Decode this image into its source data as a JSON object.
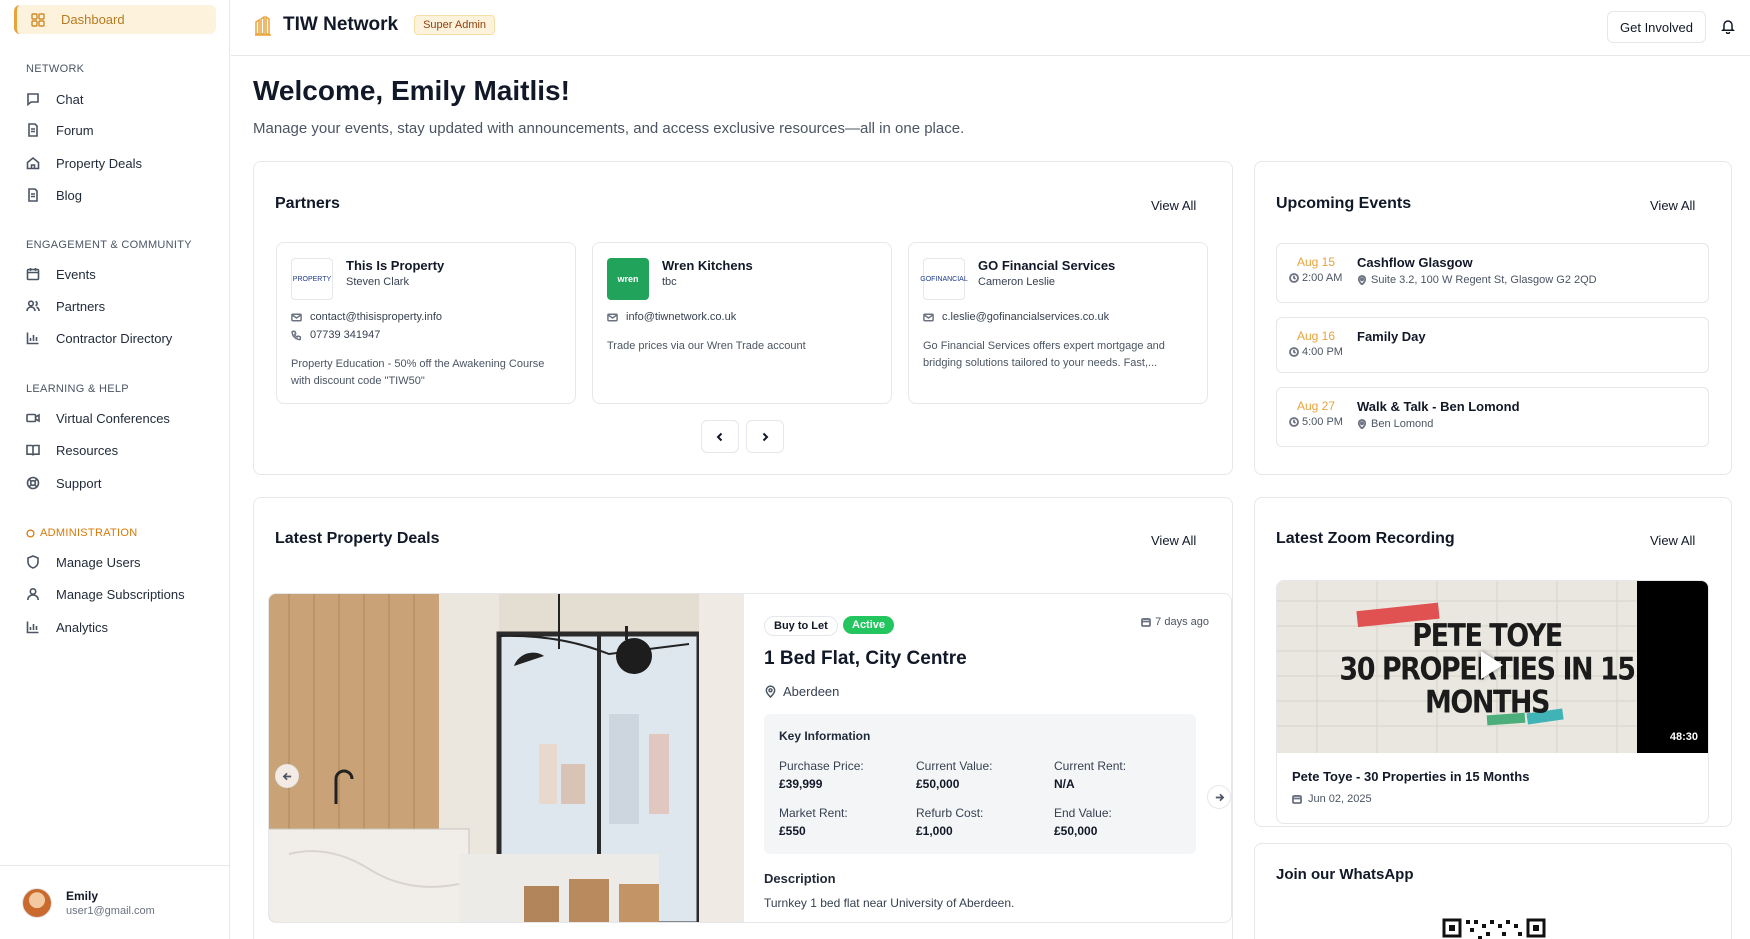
{
  "sidebar": {
    "dashboard_label": "Dashboard",
    "sections": [
      {
        "label": "NETWORK"
      },
      {
        "label": "ENGAGEMENT & COMMUNITY"
      },
      {
        "label": "LEARNING & HELP"
      },
      {
        "label": "ADMINISTRATION"
      }
    ],
    "items": [
      {
        "label": "Chat",
        "icon": "chat-icon"
      },
      {
        "label": "Forum",
        "icon": "document-icon"
      },
      {
        "label": "Property Deals",
        "icon": "home-icon"
      },
      {
        "label": "Blog",
        "icon": "document-icon"
      },
      {
        "label": "Events",
        "icon": "calendar-icon"
      },
      {
        "label": "Partners",
        "icon": "users-icon"
      },
      {
        "label": "Contractor Directory",
        "icon": "bar-chart-icon"
      },
      {
        "label": "Virtual Conferences",
        "icon": "video-icon"
      },
      {
        "label": "Resources",
        "icon": "book-icon"
      },
      {
        "label": "Support",
        "icon": "lifebuoy-icon"
      },
      {
        "label": "Manage Users",
        "icon": "shield-icon"
      },
      {
        "label": "Manage Subscriptions",
        "icon": "user-icon"
      },
      {
        "label": "Analytics",
        "icon": "bar-chart-icon"
      }
    ],
    "user": {
      "name": "Emily",
      "email": "user1@gmail.com"
    }
  },
  "header": {
    "title": "TIW Network",
    "role_badge": "Super Admin",
    "get_involved_label": "Get Involved"
  },
  "main": {
    "welcome": "Welcome, Emily Maitlis!",
    "subtitle": "Manage your events, stay updated with announcements, and access exclusive resources—all in one place.",
    "view_all": "View All",
    "partners": {
      "title": "Partners",
      "items": [
        {
          "name": "This Is Property",
          "contact": "Steven Clark",
          "email": "contact@thisisproperty.info",
          "phone": "07739 341947",
          "description": "Property Education - 50% off the Awakening Course with discount code \"TIW50\"",
          "logo_text": "PROPERTY"
        },
        {
          "name": "Wren Kitchens",
          "contact": "tbc",
          "email": "info@tiwnetwork.co.uk",
          "phone": "",
          "description": "Trade prices via our Wren Trade account",
          "logo_text": "wren"
        },
        {
          "name": "GO Financial Services",
          "contact": "Cameron Leslie",
          "email": "c.leslie@gofinancialservices.co.uk",
          "phone": "",
          "description": "Go Financial Services offers expert mortgage and bridging solutions tailored to your needs. Fast,...",
          "logo_text": "GOFINANCIAL"
        }
      ]
    },
    "events": {
      "title": "Upcoming Events",
      "items": [
        {
          "date": "Aug 15",
          "time": "2:00 AM",
          "title": "Cashflow Glasgow",
          "location": "Suite 3.2, 100 W Regent St, Glasgow G2 2QD"
        },
        {
          "date": "Aug 16",
          "time": "4:00 PM",
          "title": "Family Day",
          "location": ""
        },
        {
          "date": "Aug 27",
          "time": "5:00 PM",
          "title": "Walk & Talk - Ben Lomond",
          "location": "Ben Lomond"
        }
      ]
    },
    "deals": {
      "title": "Latest Property Deals",
      "item": {
        "type": "Buy to Let",
        "status": "Active",
        "posted": "7 days ago",
        "title": "1 Bed Flat, City Centre",
        "location": "Aberdeen",
        "key_info_title": "Key Information",
        "key_info": [
          {
            "label": "Purchase Price:",
            "value": "£39,999"
          },
          {
            "label": "Current Value:",
            "value": "£50,000"
          },
          {
            "label": "Current Rent:",
            "value": "N/A"
          },
          {
            "label": "Market Rent:",
            "value": "£550"
          },
          {
            "label": "Refurb Cost:",
            "value": "£1,000"
          },
          {
            "label": "End Value:",
            "value": "£50,000"
          }
        ],
        "description_title": "Description",
        "description": "Turnkey 1 bed flat near University of Aberdeen."
      }
    },
    "zoom": {
      "title": "Latest Zoom Recording",
      "thumb_text": "PETE TOYE\n30 PROPERTIES IN 15\nMONTHS",
      "duration": "48:30",
      "recording_title": "Pete Toye - 30 Properties in 15 Months",
      "date": "Jun 02, 2025"
    },
    "whatsapp": {
      "title": "Join our WhatsApp"
    }
  },
  "colors": {
    "accent": "#e8a33d",
    "active": "#22c55e",
    "wren": "#22a35b"
  }
}
